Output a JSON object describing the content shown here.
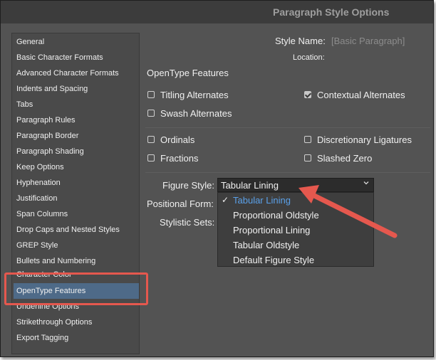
{
  "window": {
    "title": "Paragraph Style Options"
  },
  "sidebar": {
    "items": [
      {
        "label": "General"
      },
      {
        "label": "Basic Character Formats"
      },
      {
        "label": "Advanced Character Formats"
      },
      {
        "label": "Indents and Spacing"
      },
      {
        "label": "Tabs"
      },
      {
        "label": "Paragraph Rules"
      },
      {
        "label": "Paragraph Border"
      },
      {
        "label": "Paragraph Shading"
      },
      {
        "label": "Keep Options"
      },
      {
        "label": "Hyphenation"
      },
      {
        "label": "Justification"
      },
      {
        "label": "Span Columns"
      },
      {
        "label": "Drop Caps and Nested Styles"
      },
      {
        "label": "GREP Style"
      },
      {
        "label": "Bullets and Numbering"
      },
      {
        "label": "Character Color"
      },
      {
        "label": "OpenType Features"
      },
      {
        "label": "Underline Options"
      },
      {
        "label": "Strikethrough Options"
      },
      {
        "label": "Export Tagging"
      }
    ],
    "selected": "OpenType Features",
    "highlight_color": "#e5584e"
  },
  "header": {
    "style_name_label": "Style Name:",
    "style_name_value": "[Basic Paragraph]",
    "location_label": "Location:"
  },
  "section": {
    "title": "OpenType Features"
  },
  "checkboxes": {
    "titling_alternates": {
      "label": "Titling Alternates",
      "checked": false
    },
    "contextual_alternates": {
      "label": "Contextual Alternates",
      "checked": true
    },
    "swash_alternates": {
      "label": "Swash Alternates",
      "checked": false
    },
    "ordinals": {
      "label": "Ordinals",
      "checked": false
    },
    "discretionary_ligatures": {
      "label": "Discretionary Ligatures",
      "checked": false
    },
    "fractions": {
      "label": "Fractions",
      "checked": false
    },
    "slashed_zero": {
      "label": "Slashed Zero",
      "checked": false
    }
  },
  "figure_style": {
    "label": "Figure Style:",
    "value": "Tabular Lining",
    "options": [
      "Tabular Lining",
      "Proportional Oldstyle",
      "Proportional Lining",
      "Tabular Oldstyle",
      "Default Figure Style"
    ]
  },
  "positional_form": {
    "label": "Positional Form:"
  },
  "stylistic_sets": {
    "label": "Stylistic Sets:"
  },
  "annotation": {
    "arrow_color": "#e5584e"
  }
}
